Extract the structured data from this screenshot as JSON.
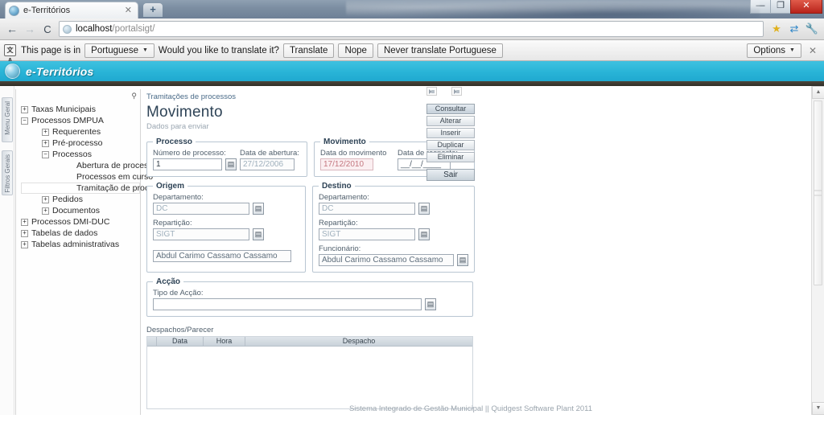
{
  "browser": {
    "tab": {
      "title": "e-Territórios",
      "close_label": "✕",
      "favicon": "globe-favicon"
    },
    "new_tab_label": "+",
    "window_controls": {
      "minimize": "—",
      "maximize": "❐",
      "close": "✕"
    },
    "nav": {
      "back": "←",
      "forward": "→",
      "reload": "C"
    },
    "omnibox": {
      "host": "localhost",
      "path": "/portalsigt/"
    },
    "toolbar_icons": {
      "bookmark": "★",
      "translate": "⇄",
      "menu": "🔧"
    }
  },
  "infobar": {
    "icon_label": "文A",
    "text_prefix": "This page is in",
    "language": "Portuguese",
    "question": "Would you like to translate it?",
    "translate_button": "Translate",
    "nope_button": "Nope",
    "never_button": "Never translate Portuguese",
    "options_button": "Options",
    "close_label": "✕"
  },
  "site": {
    "brand": "e-Territórios",
    "header_color": "#29b4d7"
  },
  "vertical_tabs": [
    {
      "label": "Menu Geral"
    },
    {
      "label": "Filtros Gerais"
    }
  ],
  "sidebar": {
    "pin_label": "⚲",
    "tree": [
      {
        "toggle": "+",
        "label": "Taxas Municipais",
        "level": 0,
        "selected": false
      },
      {
        "toggle": "−",
        "label": "Processos DMPUA",
        "level": 0,
        "selected": false
      },
      {
        "toggle": "+",
        "label": "Requerentes",
        "level": 1,
        "selected": false
      },
      {
        "toggle": "+",
        "label": "Pré-processo",
        "level": 1,
        "selected": false
      },
      {
        "toggle": "−",
        "label": "Processos",
        "level": 1,
        "selected": false
      },
      {
        "toggle": "",
        "label": "Abertura de processos",
        "level": 3,
        "selected": false
      },
      {
        "toggle": "",
        "label": "Processos em curso",
        "level": 3,
        "selected": false
      },
      {
        "toggle": "",
        "label": "Tramitação de processos",
        "level": 3,
        "selected": true
      },
      {
        "toggle": "+",
        "label": "Pedidos",
        "level": 1,
        "selected": false
      },
      {
        "toggle": "+",
        "label": "Documentos",
        "level": 1,
        "selected": false
      },
      {
        "toggle": "+",
        "label": "Processos DMI-DUC",
        "level": 0,
        "selected": false
      },
      {
        "toggle": "+",
        "label": "Tabelas de dados",
        "level": 0,
        "selected": false
      },
      {
        "toggle": "+",
        "label": "Tabelas administrativas",
        "level": 0,
        "selected": false
      }
    ]
  },
  "main": {
    "breadcrumb": "Tramitações de processos",
    "title": "Movimento",
    "subtitle": "Dados para enviar",
    "processo": {
      "legend": "Processo",
      "numero_label": "Número de processo:",
      "numero_value": "1",
      "data_abertura_label": "Data de abertura:",
      "data_abertura_value": "27/12/2006",
      "picker_icon": "grid-picker-icon"
    },
    "movimento": {
      "legend": "Movimento",
      "data_movimento_label": "Data do movimento",
      "data_movimento_value": "17/12/2010",
      "data_resposta_label": "Data de resposta:",
      "data_resposta_value": "__/__/____"
    },
    "origem": {
      "legend": "Origem",
      "departamento_label": "Departamento:",
      "departamento_value": "DC",
      "reparticao_label": "Repartição:",
      "reparticao_value": "SIGT",
      "funcionario_value": "Abdul  Carimo  Cassamo Cassamo"
    },
    "destino": {
      "legend": "Destino",
      "departamento_label": "Departamento:",
      "departamento_value": "DC",
      "reparticao_label": "Repartição:",
      "reparticao_value": "SIGT",
      "funcionario_label": "Funcionário:",
      "funcionario_value": "Abdul  Carimo  Cassamo Cassamo"
    },
    "accao": {
      "legend": "Acção",
      "tipo_label": "Tipo de Acção:",
      "tipo_value": ""
    },
    "despachos": {
      "label": "Despachos/Parecer",
      "columns": [
        "",
        "Data",
        "Hora",
        "Despacho"
      ],
      "rows": [],
      "buttons": [
        {
          "label": "Consultar",
          "primary": true
        },
        {
          "label": "Alterar",
          "primary": false
        },
        {
          "label": "Inserir",
          "primary": false
        },
        {
          "label": "Duplicar",
          "primary": false
        },
        {
          "label": "Eliminar",
          "primary": false
        }
      ],
      "exit_button": "Sair"
    },
    "footer": "Sistema Integrado de Gestão Municipal || Quidgest Software Plant 2011"
  },
  "scrollbar": {
    "up": "▲",
    "down": "▼"
  }
}
